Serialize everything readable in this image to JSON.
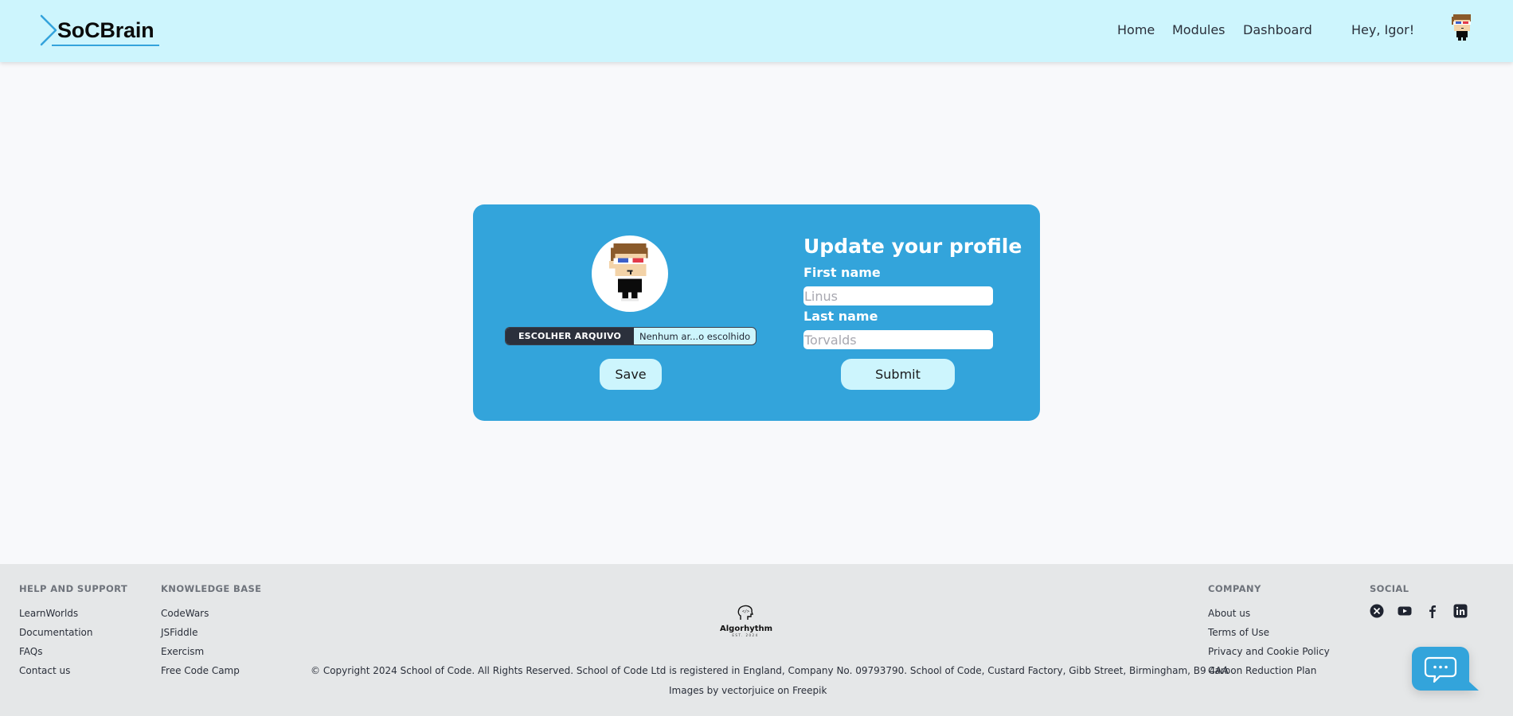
{
  "header": {
    "logo_text": "SoCBrain",
    "nav": [
      {
        "label": "Home"
      },
      {
        "label": "Modules"
      },
      {
        "label": "Dashboard"
      }
    ],
    "greeting": "Hey, Igor!",
    "avatar_icon": "pixel-avatar-3d-glasses"
  },
  "profile_card": {
    "avatar_icon": "pixel-avatar-3d-glasses",
    "file_button_label": "ESCOLHER ARQUIVO",
    "file_status": "Nenhum ar...o escolhido",
    "save_label": "Save",
    "title": "Update your profile",
    "first_name_label": "First name",
    "first_name_placeholder": "Linus",
    "first_name_value": "",
    "last_name_label": "Last name",
    "last_name_placeholder": "Torvalds",
    "last_name_value": "",
    "submit_label": "Submit"
  },
  "footer": {
    "help": {
      "heading": "HELP AND SUPPORT",
      "links": [
        "LearnWorlds",
        "Documentation",
        "FAQs",
        "Contact us"
      ]
    },
    "knowledge": {
      "heading": "KNOWLEDGE BASE",
      "links": [
        "CodeWars",
        "JSFiddle",
        "Exercism",
        "Free Code Camp"
      ]
    },
    "brand": {
      "name": "Algorhythm",
      "est": "EST. 2024"
    },
    "copyright": "© Copyright 2024 School of Code. All Rights Reserved. School of Code Ltd is registered in England, Company No. 09793790. School of Code, Custard Factory, Gibb Street, Birmingham, B9 4AA",
    "credits": "Images by vectorjuice on Freepik",
    "company": {
      "heading": "COMPANY",
      "links": [
        "About us",
        "Terms of Use",
        "Privacy and Cookie Policy",
        "Carbon Reduction Plan"
      ]
    },
    "social": {
      "heading": "SOCIAL",
      "icons": [
        "x-icon",
        "youtube-icon",
        "facebook-icon",
        "linkedin-icon"
      ]
    }
  },
  "chat": {
    "icon": "chat-bubble-icon"
  },
  "colors": {
    "header_bg": "#cdf5fd",
    "card_bg": "#33a4db",
    "button_bg": "#cdf5fd",
    "footer_bg": "#e5e7e8",
    "accent": "#34a3dc"
  }
}
